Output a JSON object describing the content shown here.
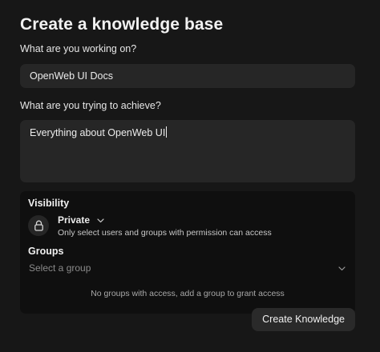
{
  "form": {
    "title": "Create a knowledge base",
    "name_label": "What are you working on?",
    "name_value": "OpenWeb UI Docs",
    "description_label": "What are you trying to achieve?",
    "description_value": "Everything about OpenWeb UI"
  },
  "access": {
    "visibility_label": "Visibility",
    "visibility_icon": "lock-icon",
    "visibility_value": "Private",
    "visibility_description": "Only select users and groups with permission can access",
    "groups_label": "Groups",
    "groups_placeholder": "Select a group",
    "groups_empty_note": "No groups with access, add a group to grant access"
  },
  "actions": {
    "create_label": "Create Knowledge"
  }
}
